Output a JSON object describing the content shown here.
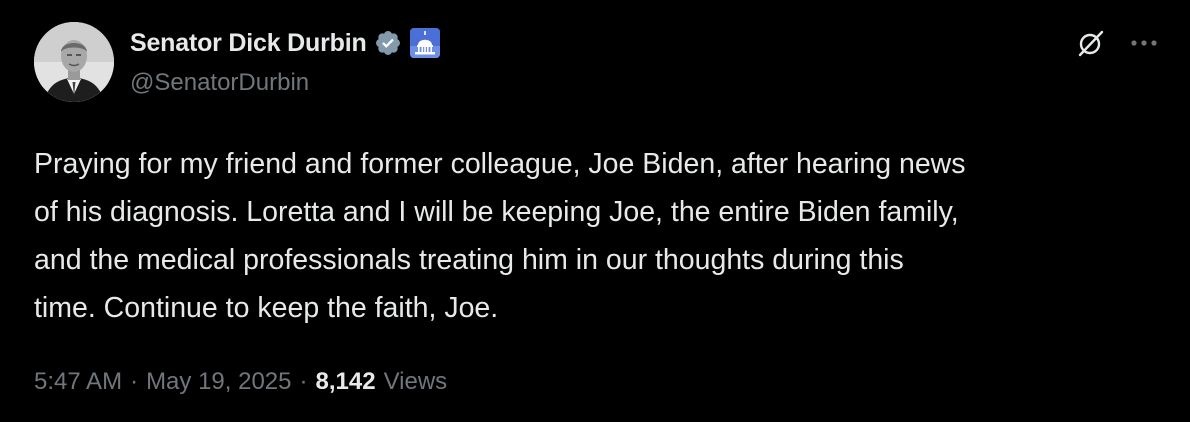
{
  "author": {
    "display_name": "Senator Dick Durbin",
    "handle": "@SenatorDurbin",
    "verified_badge": "verified-gray-badge",
    "affiliation_badge": "capitol-dome-icon"
  },
  "actions": {
    "grok_icon": "grok-icon",
    "more_icon": "more-icon"
  },
  "tweet": {
    "text": "Praying for my friend and former colleague, Joe Biden, after hearing news\nof his diagnosis. Loretta and I will be keeping Joe, the entire Biden family,\nand the medical professionals treating him in our thoughts during this\ntime. Continue to keep the faith, Joe."
  },
  "meta": {
    "time": "5:47 AM",
    "separator": "·",
    "date": "May 19, 2025",
    "views_count": "8,142",
    "views_label": "Views"
  },
  "colors": {
    "background": "#000000",
    "text_primary": "#e7e9ea",
    "text_secondary": "#71767b",
    "verified_badge": "#829aab",
    "affiliation_badge_bg": "#4a6fd6"
  }
}
